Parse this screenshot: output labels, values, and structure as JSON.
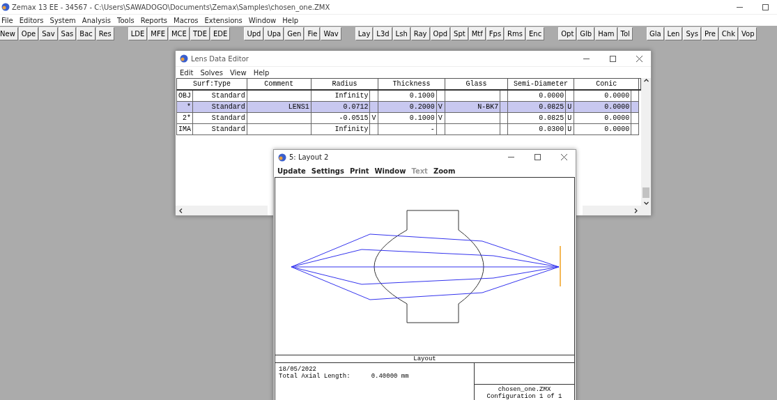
{
  "app": {
    "title": "Zemax 13 EE - 34567 - C:\\Users\\SAWADOGO\\Documents\\Zemax\\Samples\\chosen_one.ZMX"
  },
  "menu": [
    "File",
    "Editors",
    "System",
    "Analysis",
    "Tools",
    "Reports",
    "Macros",
    "Extensions",
    "Window",
    "Help"
  ],
  "toolbar": [
    [
      "New",
      "Ope",
      "Sav",
      "Sas",
      "Bac",
      "Res"
    ],
    [
      "LDE",
      "MFE",
      "MCE",
      "TDE",
      "EDE"
    ],
    [
      "Upd",
      "Upa",
      "Gen",
      "Fie",
      "Wav"
    ],
    [
      "Lay",
      "L3d",
      "Lsh",
      "Ray",
      "Opd",
      "Spt",
      "Mtf",
      "Fps",
      "Rms",
      "Enc"
    ],
    [
      "Opt",
      "Glb",
      "Ham",
      "Tol"
    ],
    [
      "Gla",
      "Len",
      "Sys",
      "Pre",
      "Chk",
      "Vop"
    ]
  ],
  "lens_data_editor": {
    "title": "Lens Data Editor",
    "menu": [
      "Edit",
      "Solves",
      "View",
      "Help"
    ],
    "columns": [
      {
        "label": "Surf:Type",
        "colspan": 2
      },
      {
        "label": "Comment"
      },
      {
        "label": "Radius",
        "colspan": 2
      },
      {
        "label": "Thickness",
        "colspan": 2
      },
      {
        "label": "Glass",
        "colspan": 2
      },
      {
        "label": "Semi-Diameter",
        "colspan": 2
      },
      {
        "label": "Conic",
        "colspan": 2
      }
    ],
    "rows": [
      {
        "selected": false,
        "cells": [
          "OBJ",
          "Standard",
          "",
          "Infinity",
          "",
          "0.1000",
          "",
          "",
          "",
          "0.0000",
          "",
          "0.0000",
          ""
        ]
      },
      {
        "selected": true,
        "cells": [
          "*",
          "Standard",
          "LENS1",
          "0.0712",
          "",
          "0.2000",
          "V",
          "N-BK7",
          "",
          "0.0825",
          "U",
          "0.0000",
          ""
        ]
      },
      {
        "selected": false,
        "cells": [
          "2*",
          "Standard",
          "",
          "-0.0515",
          "V",
          "0.1000",
          "V",
          "",
          "",
          "0.0825",
          "U",
          "0.0000",
          ""
        ]
      },
      {
        "selected": false,
        "cells": [
          "IMA",
          "Standard",
          "",
          "Infinity",
          "",
          "-",
          "",
          "",
          "",
          "0.0300",
          "U",
          "0.0000",
          ""
        ]
      }
    ]
  },
  "layout_window": {
    "title": "5: Layout 2",
    "menu": [
      {
        "label": "Update",
        "disabled": false
      },
      {
        "label": "Settings",
        "disabled": false
      },
      {
        "label": "Print",
        "disabled": false
      },
      {
        "label": "Window",
        "disabled": false
      },
      {
        "label": "Text",
        "disabled": true
      },
      {
        "label": "Zoom",
        "disabled": false
      }
    ],
    "plot_title": "Layout",
    "date": "18/05/2022",
    "axial_label": "Total Axial Length:",
    "axial_value": "0.40000 mm",
    "file": "chosen_one.ZMX",
    "configuration": "Configuration 1 of 1"
  }
}
